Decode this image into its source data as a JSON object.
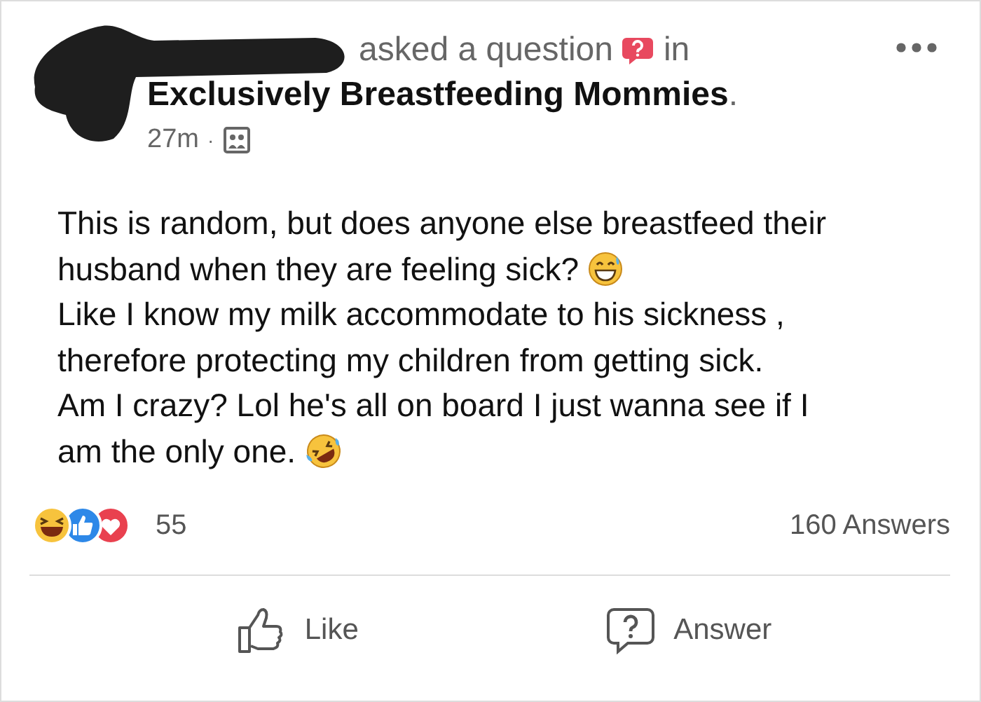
{
  "post": {
    "action_text": "asked a question",
    "in_text": "in",
    "group": "Exclusively Breastfeeding Mommies",
    "group_suffix": ".",
    "time": "27m",
    "separator": "·",
    "body_lines": [
      {
        "text": "This is random, but does anyone else breastfeed their"
      },
      {
        "text": "husband when they are feeling sick?",
        "kind": "sweat_smile"
      },
      {
        "text": "Like I know my milk accommodate to his sickness ,"
      },
      {
        "text": "therefore protecting my children from getting sick."
      },
      {
        "text": "Am I crazy? Lol he's all on board I just wanna see if I"
      },
      {
        "text": "am the only one.",
        "kind": "rofl"
      }
    ],
    "reaction_count": "55",
    "answers": "160 Answers",
    "actions": [
      {
        "kind": "like",
        "label": "Like"
      },
      {
        "kind": "answer",
        "label": "Answer"
      }
    ]
  }
}
